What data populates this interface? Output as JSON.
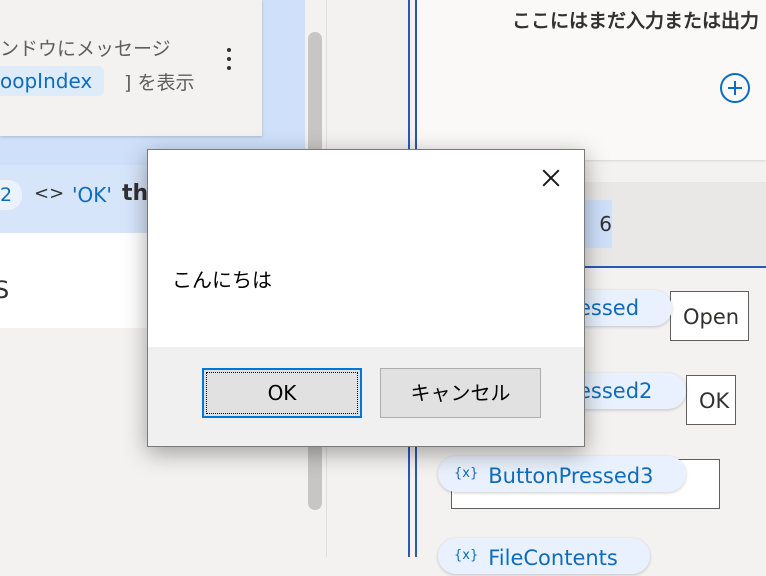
{
  "left_pane": {
    "action_card": {
      "line1": "ンドウにメッセージ",
      "variable_token": "oopIndex",
      "line2_suffix": "] を表示",
      "more_glyph": "more-vertical-icon"
    },
    "condition": {
      "operand_fragment": "2",
      "operator": "<>",
      "value": "'OK'",
      "keyword_fragment": "th"
    },
    "step_fragment": "S"
  },
  "right_pane": {
    "io_empty_text": "ここにはまだ入力または出力",
    "flow_variables_count_fragment": "6",
    "variables": [
      {
        "name_fragment": "essed",
        "value": "Open"
      },
      {
        "name_fragment": "essed2",
        "value": "OK"
      },
      {
        "icon": "{x}",
        "name": "ButtonPressed3",
        "value": ""
      },
      {
        "icon": "{x}",
        "name": "FileContents",
        "value": ""
      }
    ]
  },
  "dialog": {
    "message": "こんにちは",
    "ok_label": "OK",
    "cancel_label": "キャンセル"
  },
  "colors": {
    "accent": "#0f6cbd",
    "selection": "#cfe0fa",
    "pane_border": "#2b57b5",
    "dialog_default_border": "#0078d7"
  }
}
